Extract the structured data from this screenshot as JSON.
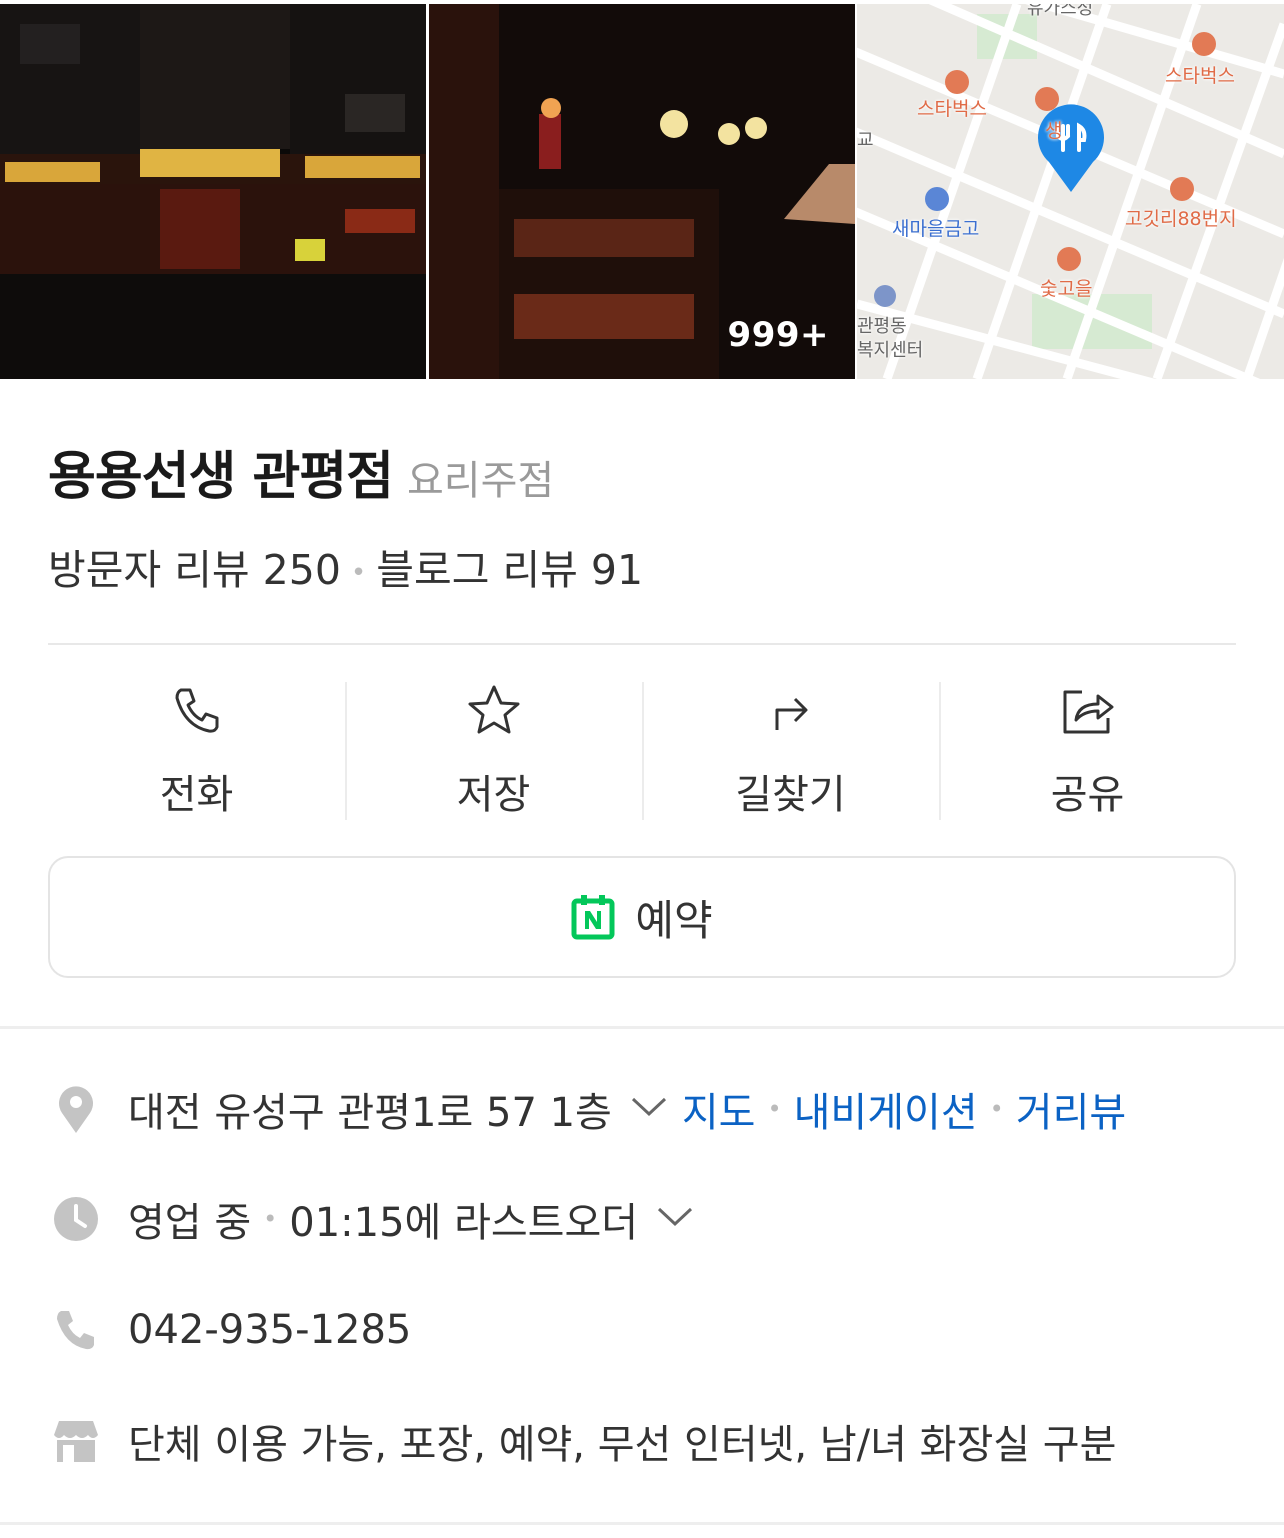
{
  "photos": {
    "count_badge": "999+",
    "map_labels": {
      "top": "유가스정",
      "starbucks_1": "스타벅스",
      "starbucks_2": "스타벅스",
      "saemaeul": "새마을금고",
      "gogitri": "고깃리88번지",
      "sulgoeum": "숯고을",
      "welfare_1": "관평동",
      "welfare_2": "복지센터",
      "partial_1": "생",
      "partial_2": "교"
    }
  },
  "place": {
    "name": "용용선생 관평점",
    "category": "요리주점",
    "visitor_reviews": "방문자 리뷰 250",
    "blog_reviews": "블로그 리뷰 91"
  },
  "actions": [
    {
      "label": "전화",
      "icon": "phone-icon"
    },
    {
      "label": "저장",
      "icon": "star-icon"
    },
    {
      "label": "길찾기",
      "icon": "directions-icon"
    },
    {
      "label": "공유",
      "icon": "share-icon"
    }
  ],
  "reservation": {
    "label": "예약",
    "icon": "naver-calendar-icon",
    "accent": "#03c75a"
  },
  "info": {
    "address": "대전 유성구 관평1로 57 1층",
    "address_links": [
      "지도",
      "내비게이션",
      "거리뷰"
    ],
    "status": "영업 중",
    "last_order": "01:15에 라스트오더",
    "phone": "042-935-1285",
    "amenities": "단체 이용 가능, 포장, 예약, 무선 인터넷, 남/녀 화장실 구분"
  },
  "colors": {
    "link": "#0b62c4",
    "pin": "#1e88e5",
    "icon_gray": "#c4c4c4"
  }
}
